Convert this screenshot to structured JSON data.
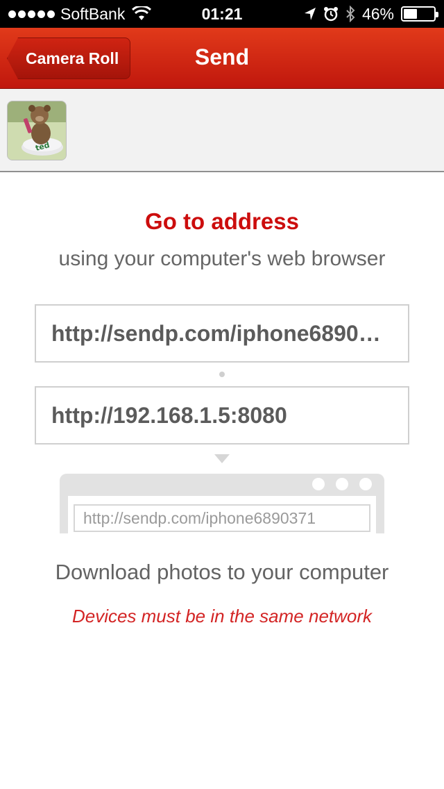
{
  "status_bar": {
    "carrier": "SoftBank",
    "time": "01:21",
    "battery_percent": "46%",
    "battery_level": 0.46,
    "icons": [
      "signal-dots",
      "wifi-icon",
      "location-arrow-icon",
      "alarm-icon",
      "bluetooth-icon",
      "battery-icon"
    ]
  },
  "nav": {
    "back_label": "Camera Roll",
    "title": "Send"
  },
  "thumbnails": [
    {
      "name": "photo-thumbnail",
      "selected": false
    }
  ],
  "main": {
    "heading": "Go to address",
    "subheading": "using your computer's web browser",
    "url_primary": "http://sendp.com/iphone6890371",
    "url_local": "http://192.168.1.5:8080",
    "browser_address": "http://sendp.com/iphone6890371",
    "download_text": "Download photos to your computer",
    "network_note": "Devices must be in the same network"
  },
  "colors": {
    "accent": "#cc0d0d",
    "nav_top": "#e13a1a",
    "nav_bottom": "#c0170d"
  }
}
